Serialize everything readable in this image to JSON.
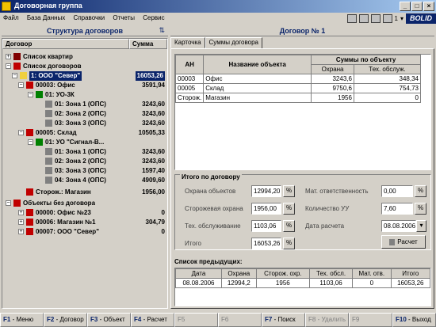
{
  "window": {
    "title": "Договорная группа"
  },
  "menu": [
    "Файл",
    "База Данных",
    "Справочки",
    "Отчеты",
    "Сервис"
  ],
  "toolbar": {
    "selector_value": "1",
    "brand": "BOLID"
  },
  "left": {
    "title": "Структура договоров",
    "col_contract": "Договор",
    "col_sum": "Сумма",
    "rows": [
      {
        "label": "Список квартир",
        "value": ""
      },
      {
        "label": "Список договоров",
        "value": ""
      },
      {
        "label": "1: ООО \"Север\"",
        "value": "16053,26"
      },
      {
        "label": "00003: Офис",
        "value": "3591,94"
      },
      {
        "label": "01: УО-3К",
        "value": ""
      },
      {
        "label": "01: Зона 1 (ОПС)",
        "value": "3243,60"
      },
      {
        "label": "02: Зона 2 (ОПС)",
        "value": "3243,60"
      },
      {
        "label": "03: Зона 3 (ОПС)",
        "value": "3243,60"
      },
      {
        "label": "00005: Склад",
        "value": "10505,33"
      },
      {
        "label": "01: УО \"Сигнал-В...",
        "value": ""
      },
      {
        "label": "01: Зона 1 (ОПС)",
        "value": "3243,60"
      },
      {
        "label": "02: Зона 2 (ОПС)",
        "value": "3243,60"
      },
      {
        "label": "03: Зона 3 (ОПС)",
        "value": "1597,40"
      },
      {
        "label": "04: Зона 4 (ОПС)",
        "value": "4909,60"
      },
      {
        "label": "Сторож.: Магазин",
        "value": "1956,00"
      },
      {
        "label": "Объекты без договора",
        "value": ""
      },
      {
        "label": "00000: Офис №23",
        "value": "0"
      },
      {
        "label": "00006: Магазин №1",
        "value": "304,79"
      },
      {
        "label": "00007: ООО \"Север\"",
        "value": "0"
      }
    ]
  },
  "right": {
    "title": "Договор № 1",
    "tabs": [
      "Карточка",
      "Суммы договора"
    ],
    "objects": {
      "col_an": "АН",
      "col_name": "Название объекта",
      "col_sums": "Суммы по объекту",
      "col_guard": "Охрана",
      "col_tech": "Тех. обслуж.",
      "rows": [
        {
          "an": "00003",
          "name": "Офис",
          "guard": "3243,6",
          "tech": "348,34"
        },
        {
          "an": "00005",
          "name": "Склад",
          "guard": "9750,6",
          "tech": "754,73"
        },
        {
          "an": "Сторож.",
          "name": "Магазин",
          "guard": "1956",
          "tech": "0"
        }
      ]
    },
    "totals": {
      "title": "Итого по договору",
      "guard_label": "Охрана объектов",
      "guard_value": "12994,20",
      "watch_label": "Сторожевая охрана",
      "watch_value": "1956,00",
      "tech_label": "Тех. обслуживание",
      "tech_value": "1103,06",
      "total_label": "Итого",
      "total_value": "16053,26",
      "resp_label": "Мат. ответственность",
      "resp_value": "0,00",
      "uu_label": "Количество УУ",
      "uu_value": "7,60",
      "date_label": "Дата расчета",
      "date_value": "08.08.2006",
      "calc_button": "Расчет"
    },
    "previous": {
      "title": "Список предыдущих:",
      "headers": [
        "Дата",
        "Охрана",
        "Сторож. охр.",
        "Тех. обсл.",
        "Мат. отв.",
        "Итого"
      ],
      "rows": [
        [
          "08.08.2006",
          "12994,2",
          "1956",
          "1103,06",
          "0",
          "16053,26"
        ]
      ]
    }
  },
  "fkeys": [
    {
      "key": "F1",
      "label": " - Меню",
      "enabled": true
    },
    {
      "key": "F2",
      "label": " - Договор",
      "enabled": true
    },
    {
      "key": "F3",
      "label": " - Объект",
      "enabled": true
    },
    {
      "key": "F4",
      "label": " - Расчет",
      "enabled": true
    },
    {
      "key": "F5",
      "label": "",
      "enabled": false
    },
    {
      "key": "F6",
      "label": "",
      "enabled": false
    },
    {
      "key": "F7",
      "label": " - Поиск",
      "enabled": true
    },
    {
      "key": "F8",
      "label": " - Удалить",
      "enabled": false
    },
    {
      "key": "F9",
      "label": "",
      "enabled": false
    },
    {
      "key": "F10",
      "label": " - Выход",
      "enabled": true
    }
  ]
}
